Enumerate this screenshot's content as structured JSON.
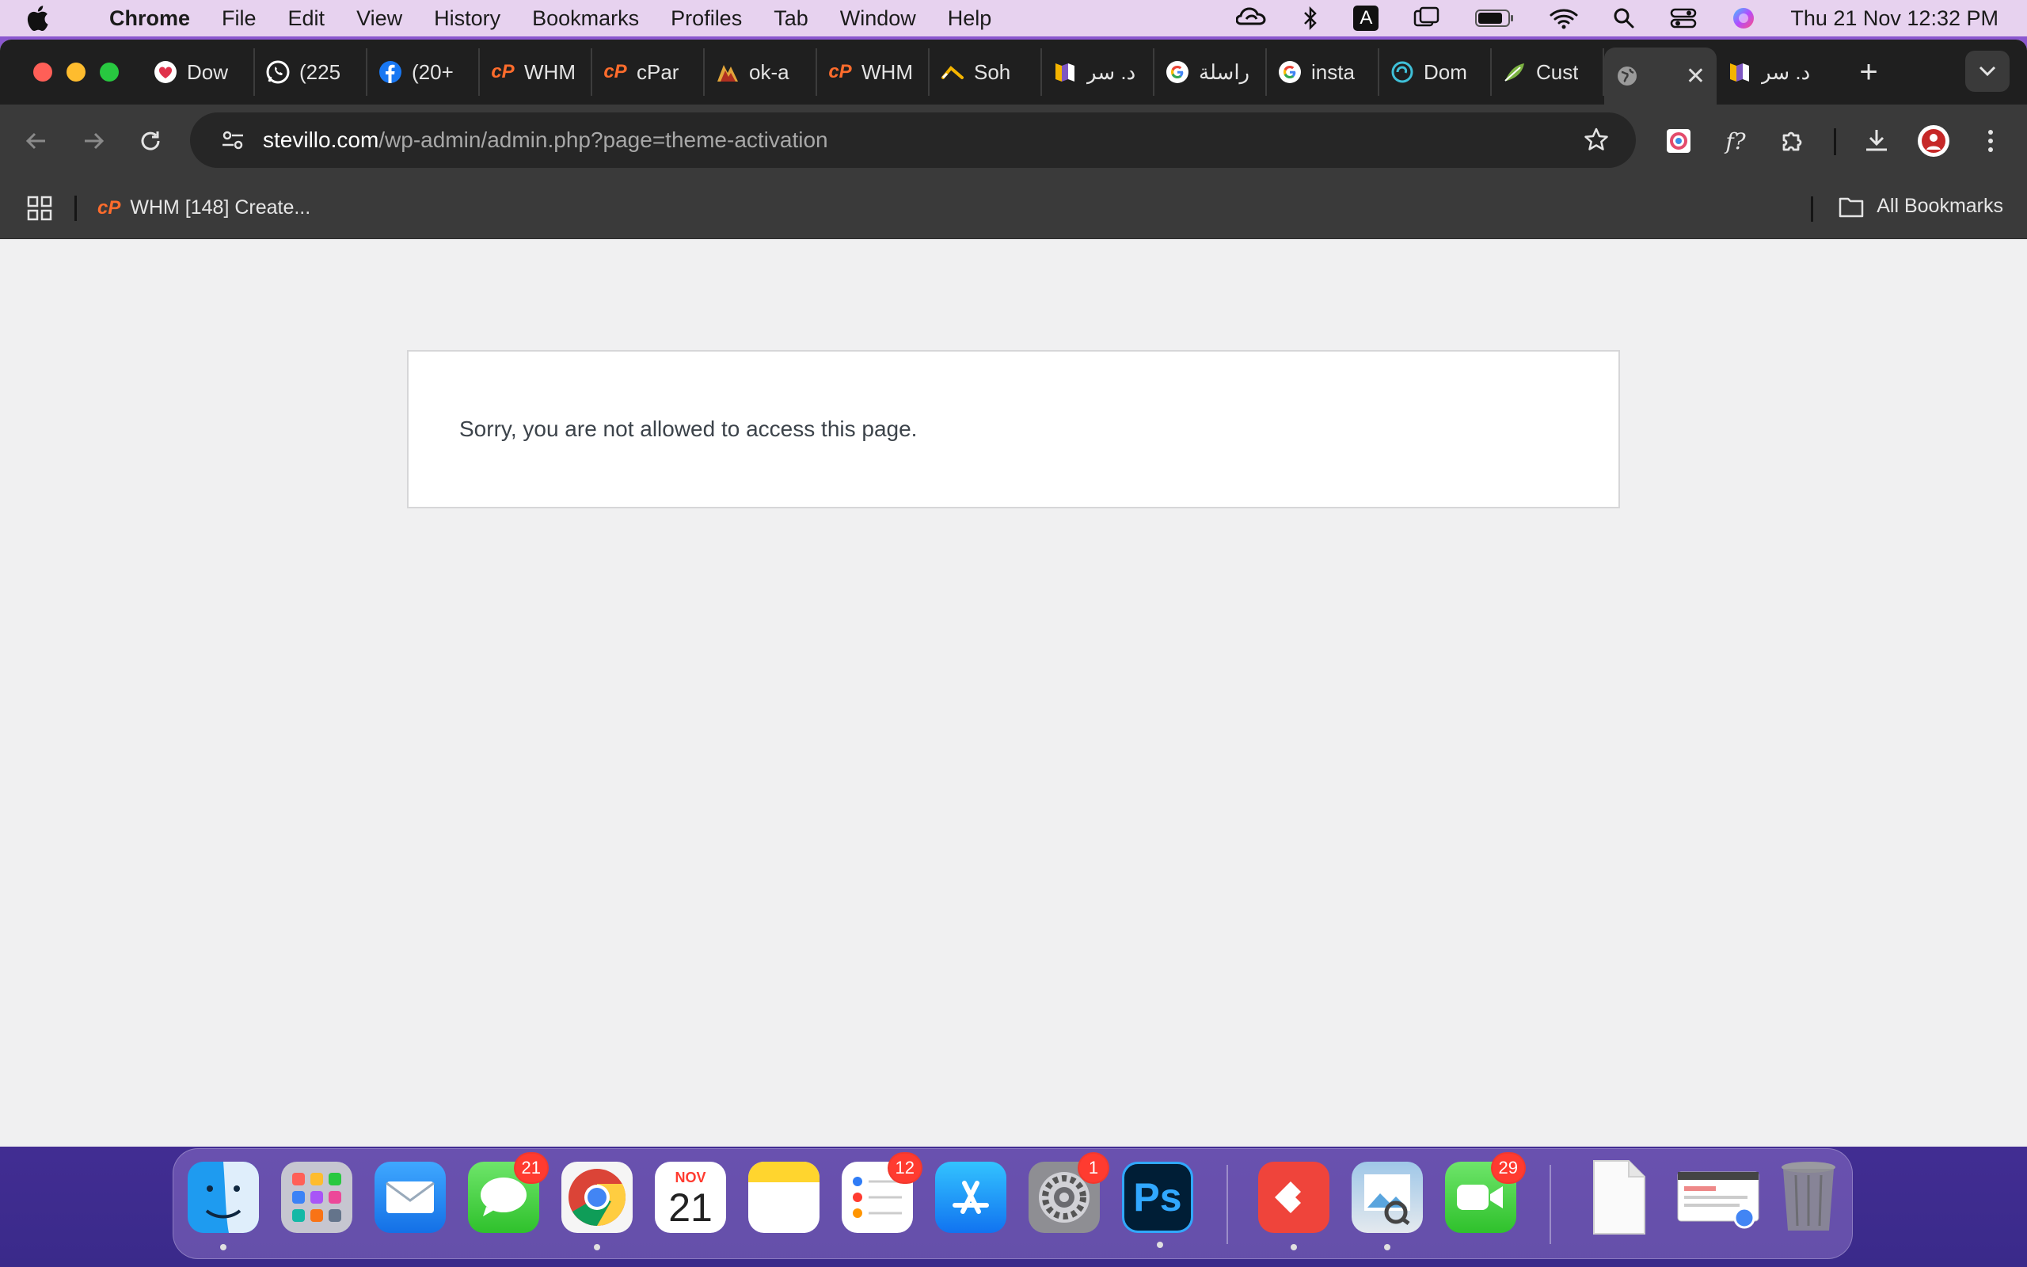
{
  "menubar": {
    "app_name": "Chrome",
    "items": [
      "File",
      "Edit",
      "View",
      "History",
      "Bookmarks",
      "Profiles",
      "Tab",
      "Window",
      "Help"
    ],
    "input_source": "A",
    "clock": "Thu 21 Nov  12:32 PM"
  },
  "tabs": [
    {
      "label": "Dow",
      "icon": "heart-icon"
    },
    {
      "label": "(225",
      "icon": "whatsapp-icon"
    },
    {
      "label": "(20+",
      "icon": "facebook-icon"
    },
    {
      "label": "WHM",
      "icon": "cpanel-icon"
    },
    {
      "label": "cPar",
      "icon": "cpanel-icon"
    },
    {
      "label": "ok-a",
      "icon": "mountain-icon"
    },
    {
      "label": "WHM",
      "icon": "cpanel-icon"
    },
    {
      "label": "Soh",
      "icon": "arrow-logo-icon"
    },
    {
      "label": "د. سر",
      "icon": "book-icon"
    },
    {
      "label": "راسلة",
      "icon": "google-icon"
    },
    {
      "label": "insta",
      "icon": "google-icon"
    },
    {
      "label": "Dom",
      "icon": "swirl-icon"
    },
    {
      "label": "Cust",
      "icon": "leaf-icon"
    }
  ],
  "active_tab": {
    "label": "",
    "icon": "globe-icon",
    "close": "✕"
  },
  "after_tab": {
    "label": "د. سر",
    "icon": "book-icon"
  },
  "new_tab": "+",
  "omnibox": {
    "domain": "stevillo.com",
    "path": "/wp-admin/admin.php?page=theme-activation"
  },
  "bookmarks": {
    "item": "WHM [148] Create...",
    "all": "All Bookmarks"
  },
  "page": {
    "message": "Sorry, you are not allowed to access this page."
  },
  "dock": {
    "messages_badge": "21",
    "calendar_month": "NOV",
    "calendar_day": "21",
    "reminders_badge": "12",
    "settings_badge": "1",
    "photoshop_label": "Ps",
    "facetime_badge": "29"
  },
  "colors": {
    "menubar_bg": "#e7d2ef",
    "tabstrip_bg": "#1f1f1f",
    "toolbar_bg": "#3a3a3a",
    "page_bg": "#f0f0f1",
    "message_text": "#3c434a"
  }
}
